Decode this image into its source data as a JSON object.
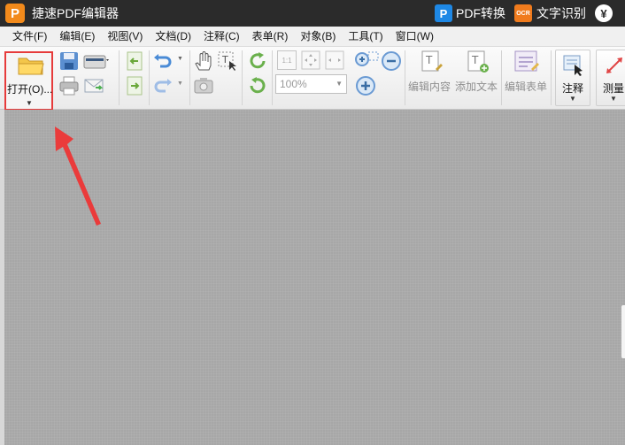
{
  "app": {
    "title": "捷速PDF编辑器",
    "logo_letter": "P",
    "pdf_convert_label": "PDF转换",
    "pdf_convert_icon_letter": "P",
    "ocr_label": "文字识别",
    "ocr_badge": "OCR",
    "vip_symbol": "¥"
  },
  "menu": [
    "文件(F)",
    "编辑(E)",
    "视图(V)",
    "文档(D)",
    "注释(C)",
    "表单(R)",
    "对象(B)",
    "工具(T)",
    "窗口(W)"
  ],
  "toolbar": {
    "open_label": "打开(O)...",
    "zoom_value": "100%",
    "page_fit_1": "1:1",
    "edit_content_label": "编辑内容",
    "add_text_label": "添加文本",
    "edit_form_label": "编辑表单",
    "annotate_label": "注释",
    "measure_label": "测量"
  },
  "colors": {
    "titlebar_bg": "#2b2b2b",
    "highlight_red": "#e63b3b",
    "doc_background": "#a7a7a7"
  }
}
